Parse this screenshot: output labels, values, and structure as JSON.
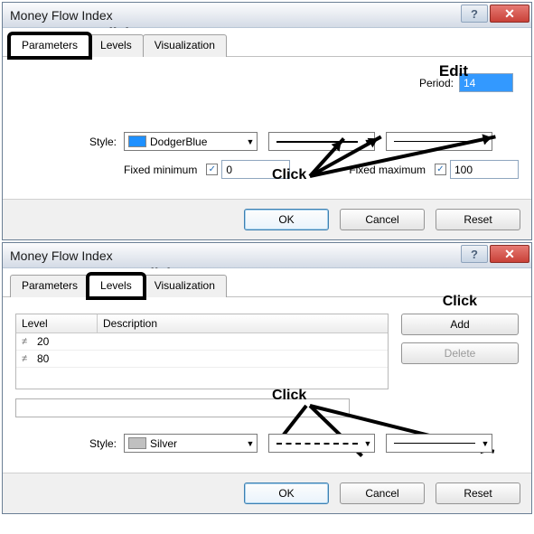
{
  "dialog1": {
    "title": "Money Flow Index",
    "tabs": [
      "Parameters",
      "Levels",
      "Visualization"
    ],
    "activeTab": 0,
    "periodLabel": "Period:",
    "periodValue": "14",
    "styleLabel": "Style:",
    "colorName": "DodgerBlue",
    "colorHex": "#1e90ff",
    "fixedMinLabel": "Fixed minimum",
    "fixedMinChecked": true,
    "fixedMinValue": "0",
    "fixedMaxLabel": "Fixed maximum",
    "fixedMaxChecked": true,
    "fixedMaxValue": "100",
    "buttons": {
      "ok": "OK",
      "cancel": "Cancel",
      "reset": "Reset"
    },
    "annot": {
      "tab": "Click",
      "period": "Edit",
      "combos": "Click"
    }
  },
  "dialog2": {
    "title": "Money Flow Index",
    "tabs": [
      "Parameters",
      "Levels",
      "Visualization"
    ],
    "activeTab": 1,
    "table": {
      "headers": [
        "Level",
        "Description"
      ],
      "rows": [
        {
          "level": "20",
          "desc": ""
        },
        {
          "level": "80",
          "desc": ""
        }
      ]
    },
    "add": "Add",
    "delete": "Delete",
    "styleLabel": "Style:",
    "colorName": "Silver",
    "colorHex": "#c0c0c0",
    "buttons": {
      "ok": "OK",
      "cancel": "Cancel",
      "reset": "Reset"
    },
    "annot": {
      "tab": "Click",
      "add": "Click",
      "combos": "Click"
    }
  }
}
